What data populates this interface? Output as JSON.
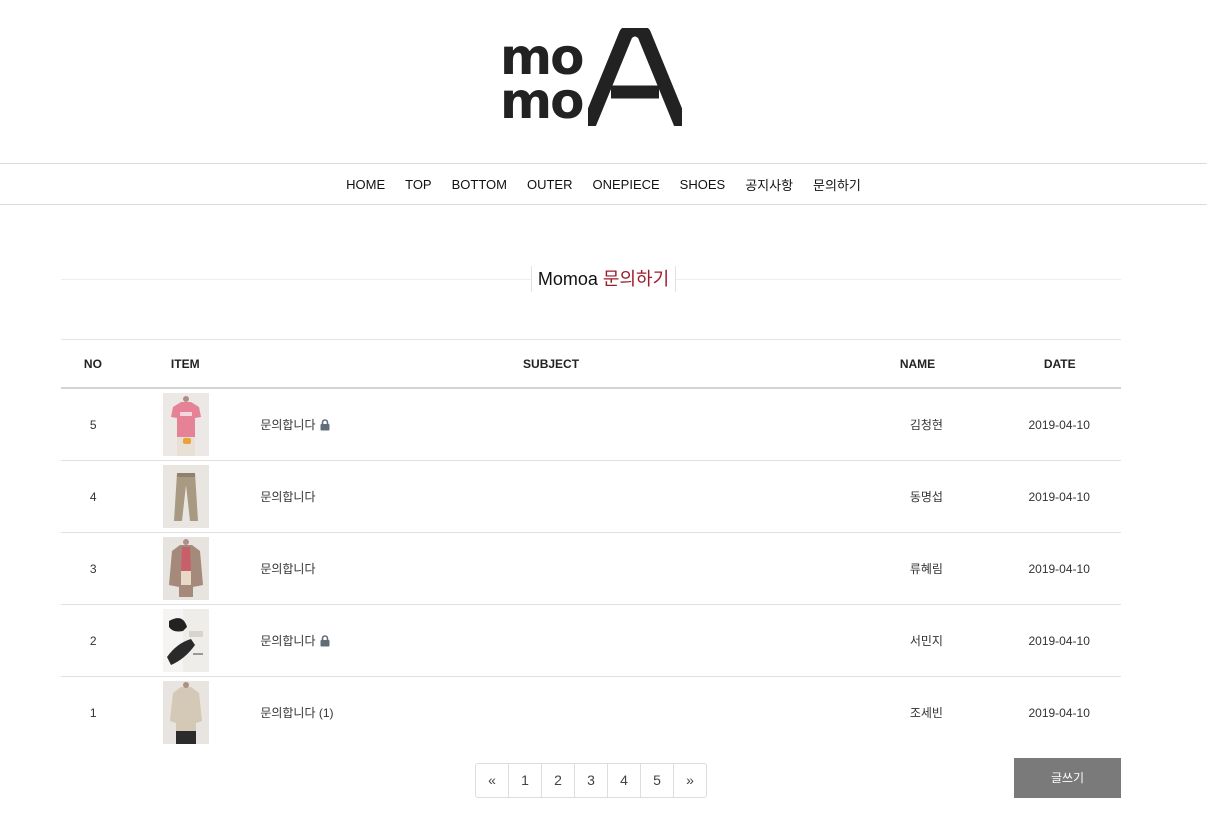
{
  "logo": {
    "line1": "mo",
    "line2": "mo",
    "big_letter": "A"
  },
  "nav": [
    "HOME",
    "TOP",
    "BOTTOM",
    "OUTER",
    "ONEPIECE",
    "SHOES",
    "공지사항",
    "문의하기"
  ],
  "board": {
    "brand": "Momoa",
    "title": "문의하기",
    "headers": {
      "no": "NO",
      "item": "ITEM",
      "subject": "SUBJECT",
      "name": "NAME",
      "date": "DATE"
    },
    "rows": [
      {
        "no": "5",
        "subject": "문의합니다",
        "locked": true,
        "name": "김청현",
        "date": "2019-04-10",
        "thumb": "pink-tshirt"
      },
      {
        "no": "4",
        "subject": "문의합니다",
        "locked": false,
        "name": "동명섭",
        "date": "2019-04-10",
        "thumb": "beige-pants"
      },
      {
        "no": "3",
        "subject": "문의합니다",
        "locked": false,
        "name": "류혜림",
        "date": "2019-04-10",
        "thumb": "brown-jacket"
      },
      {
        "no": "2",
        "subject": "문의합니다",
        "locked": true,
        "name": "서민지",
        "date": "2019-04-10",
        "thumb": "black-shoes"
      },
      {
        "no": "1",
        "subject": "문의합니다 (1)",
        "locked": false,
        "name": "조세빈",
        "date": "2019-04-10",
        "thumb": "beige-blouse"
      }
    ]
  },
  "pagination": [
    "«",
    "1",
    "2",
    "3",
    "4",
    "5",
    "»"
  ],
  "write_button": "글쓰기",
  "colors": {
    "accent": "#9b1c2c",
    "button": "#7a7a7a",
    "border": "#dddddd"
  },
  "icons": {
    "lock": "lock-icon"
  }
}
